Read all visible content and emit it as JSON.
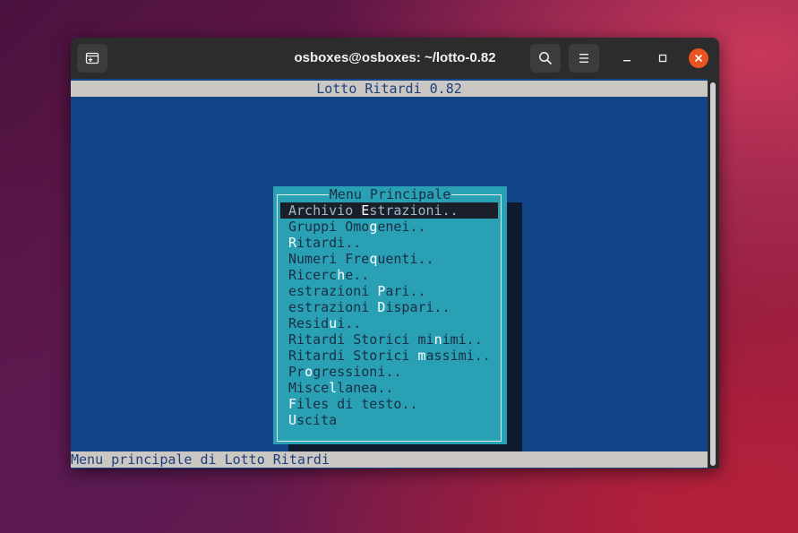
{
  "window": {
    "title": "osboxes@osboxes: ~/lotto-0.82"
  },
  "terminal": {
    "app_title": "Lotto Ritardi 0.82",
    "status": "Menu principale di Lotto Ritardi"
  },
  "dialog": {
    "title": "Menu Principale",
    "items": [
      {
        "pre": "Archivio ",
        "hk": "E",
        "post": "strazioni..",
        "selected": true
      },
      {
        "pre": "Gruppi Omo",
        "hk": "g",
        "post": "enei..",
        "selected": false
      },
      {
        "pre": "",
        "hk": "R",
        "post": "itardi..",
        "selected": false
      },
      {
        "pre": "Numeri Fre",
        "hk": "q",
        "post": "uenti..",
        "selected": false
      },
      {
        "pre": "Ricerc",
        "hk": "h",
        "post": "e..",
        "selected": false
      },
      {
        "pre": "estrazioni ",
        "hk": "P",
        "post": "ari..",
        "selected": false
      },
      {
        "pre": "estrazioni ",
        "hk": "D",
        "post": "ispari..",
        "selected": false
      },
      {
        "pre": "Resid",
        "hk": "u",
        "post": "i..",
        "selected": false
      },
      {
        "pre": "Ritardi Storici mi",
        "hk": "n",
        "post": "imi..",
        "selected": false
      },
      {
        "pre": "Ritardi Storici ",
        "hk": "m",
        "post": "assimi..",
        "selected": false
      },
      {
        "pre": "Pr",
        "hk": "o",
        "post": "gressioni..",
        "selected": false
      },
      {
        "pre": "Misce",
        "hk": "l",
        "post": "lanea..",
        "selected": false
      },
      {
        "pre": "",
        "hk": "F",
        "post": "iles di testo..",
        "selected": false
      },
      {
        "pre": "",
        "hk": "U",
        "post": "scita",
        "selected": false
      }
    ]
  },
  "icons": {
    "new_tab": "new-tab-icon",
    "search": "search-icon",
    "menu": "hamburger-menu-icon",
    "minimize": "minimize-icon",
    "maximize": "maximize-icon",
    "close": "close-icon"
  },
  "colors": {
    "terminal_bg": "#134487",
    "dialog_bg": "#29a0b3",
    "close_button": "#e95420"
  }
}
